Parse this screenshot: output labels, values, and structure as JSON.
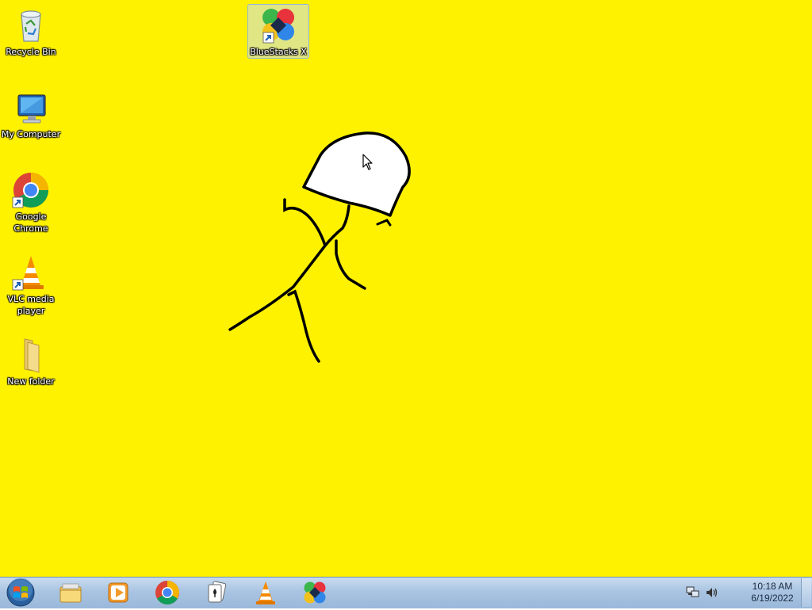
{
  "desktop": {
    "background_color": "#FFF200",
    "icons": [
      {
        "label": "Recycle Bin",
        "icon": "recycle-bin-icon"
      },
      {
        "label": "My Computer",
        "icon": "computer-icon"
      },
      {
        "label": "Google Chrome",
        "icon": "chrome-icon"
      },
      {
        "label": "VLC media player",
        "icon": "vlc-icon"
      },
      {
        "label": "New folder",
        "icon": "folder-icon"
      },
      {
        "label": "BlueStacks X",
        "icon": "bluestacks-icon",
        "selected": true
      }
    ]
  },
  "taskbar": {
    "start_icon": "windows-start-icon",
    "pinned": [
      {
        "name": "File Explorer",
        "icon": "folder-library-icon"
      },
      {
        "name": "Windows Media Player",
        "icon": "media-player-icon"
      },
      {
        "name": "Google Chrome",
        "icon": "chrome-icon"
      },
      {
        "name": "Solitaire",
        "icon": "cards-icon"
      },
      {
        "name": "VLC media player",
        "icon": "vlc-icon"
      },
      {
        "name": "BlueStacks X",
        "icon": "bluestacks-icon"
      }
    ],
    "tray": {
      "network_icon": "network-icon",
      "volume_icon": "volume-icon",
      "time": "10:18 AM",
      "date": "6/19/2022"
    }
  }
}
